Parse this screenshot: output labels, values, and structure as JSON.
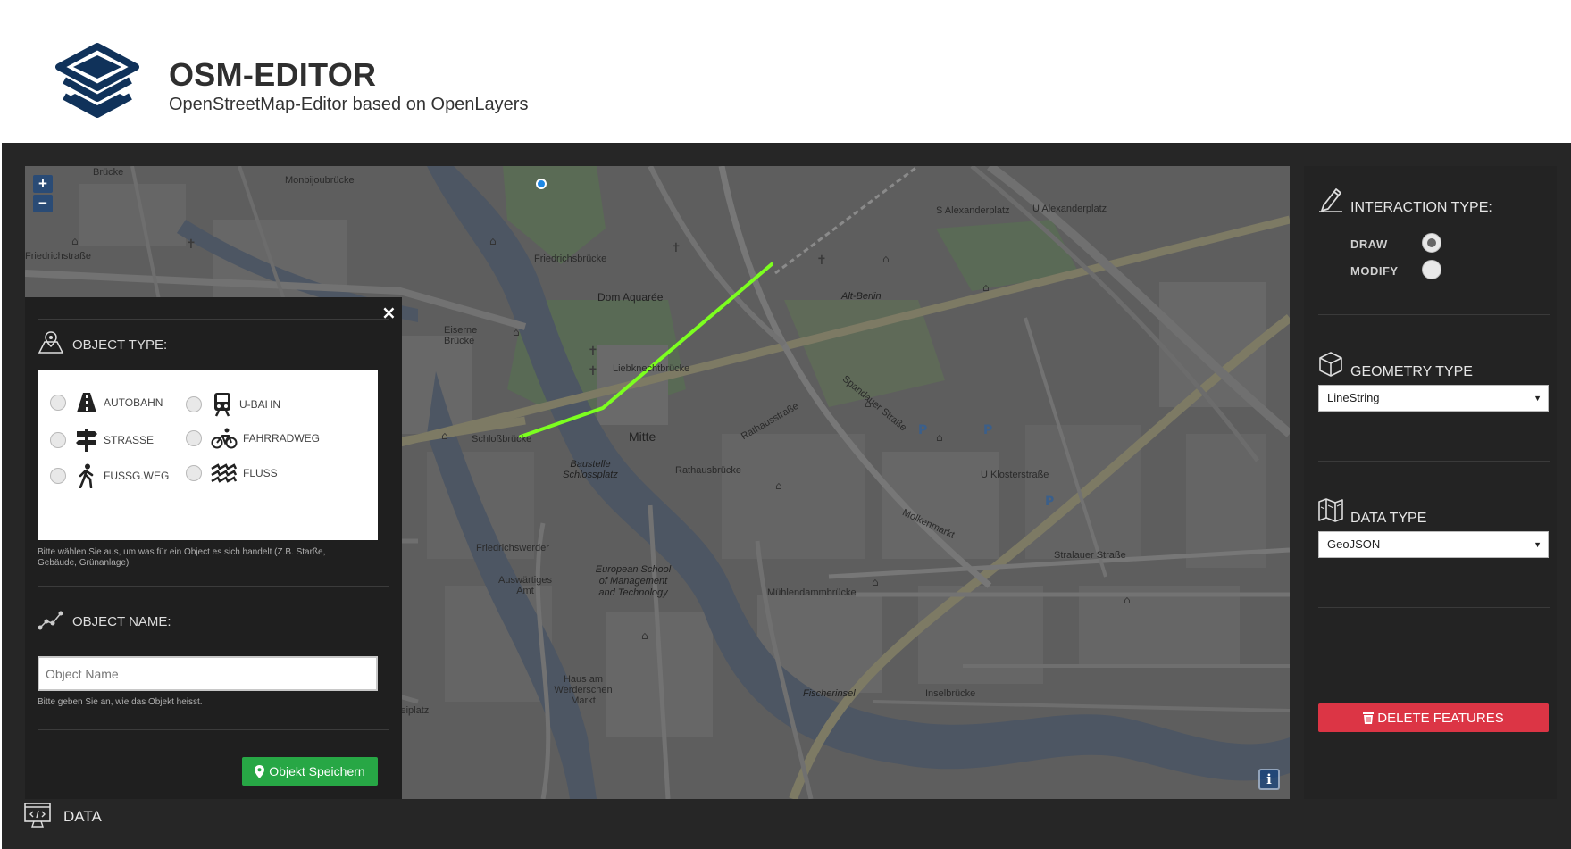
{
  "header": {
    "title": "OSM-EDITOR",
    "subtitle": "OpenStreetMap-Editor based on OpenLayers"
  },
  "map": {
    "zoom_in": "+",
    "zoom_out": "−",
    "info": "i",
    "drawn_line_color": "#7cff1f",
    "labels": {
      "bruecke": "Brücke",
      "monbijou": "Monbijoubrücke",
      "friedrichsbruecke": "Friedrichsbrücke",
      "dom_aquaree": "Dom Aquarée",
      "alexanderplatz": "S Alexanderplatz",
      "u_alexanderplatz": "U Alexanderplatz",
      "eiserne_bruecke": "Eiserne Brücke",
      "alt_berlin": "Alt-Berlin",
      "liebknechtbruecke": "Liebknechtbrücke",
      "schlossbruecke": "Schloßbrücke",
      "mitte": "Mitte",
      "rathausbruecke": "Rathausbrücke",
      "baustelle_schlossplatz": "Baustelle Schlossplatz",
      "friedrichswerder": "Friedrichswerder",
      "auswaertiges_amt": "Auswärtiges Amt",
      "european_school": "European School of Management and Technology",
      "muehlendammbruecke": "Mühlendammbrücke",
      "u_klosterstrasse": "U Klosterstraße",
      "hausvogteiplatz": "Hausvogteiplatz",
      "inselbruecke": "Inselbrücke",
      "fischerinsel": "Fischerinsel",
      "haus_werderschen_markt": "Haus am Werderschen Markt",
      "spandauer_strasse": "Spandauer Straße",
      "rathausstrasse": "Rathausstraße",
      "molkenmarkt": "Molkenmarkt",
      "stralauer_strasse": "Stralauer Straße",
      "friedrichstrasse": "Friedrichstraße"
    }
  },
  "object_panel": {
    "close": "×",
    "object_type_title": "OBJECT TYPE:",
    "object_types": [
      {
        "label": "AUTOBAHN",
        "icon": "road-icon"
      },
      {
        "label": "U-BAHN",
        "icon": "train-icon"
      },
      {
        "label": "STRASSE",
        "icon": "signpost-icon"
      },
      {
        "label": "FAHRRADWEG",
        "icon": "bicycle-icon"
      },
      {
        "label": "FUSSG.WEG",
        "icon": "walking-icon"
      },
      {
        "label": "FLUSS",
        "icon": "water-icon"
      }
    ],
    "object_type_hint": "Bitte wählen Sie aus, um was für ein Object es sich handelt (Z.B. Starße, Gebäude, Grünanlage)",
    "object_name_title": "OBJECT NAME:",
    "object_name_placeholder": "Object Name",
    "object_name_hint": "Bitte geben Sie an, wie das Objekt heisst.",
    "save_label": "Objekt Speichern",
    "save_color": "#27a745"
  },
  "right_panel": {
    "interaction_title": "INTERACTION TYPE:",
    "interaction_options": [
      {
        "label": "DRAW",
        "checked": true
      },
      {
        "label": "MODIFY",
        "checked": false
      }
    ],
    "geometry_title": "GEOMETRY TYPE",
    "geometry_value": "LineString",
    "data_type_title": "DATA TYPE",
    "data_type_value": "GeoJSON",
    "delete_label": "DELETE FEATURES",
    "delete_color": "#dc3545"
  },
  "data_section": {
    "title": "DATA"
  }
}
